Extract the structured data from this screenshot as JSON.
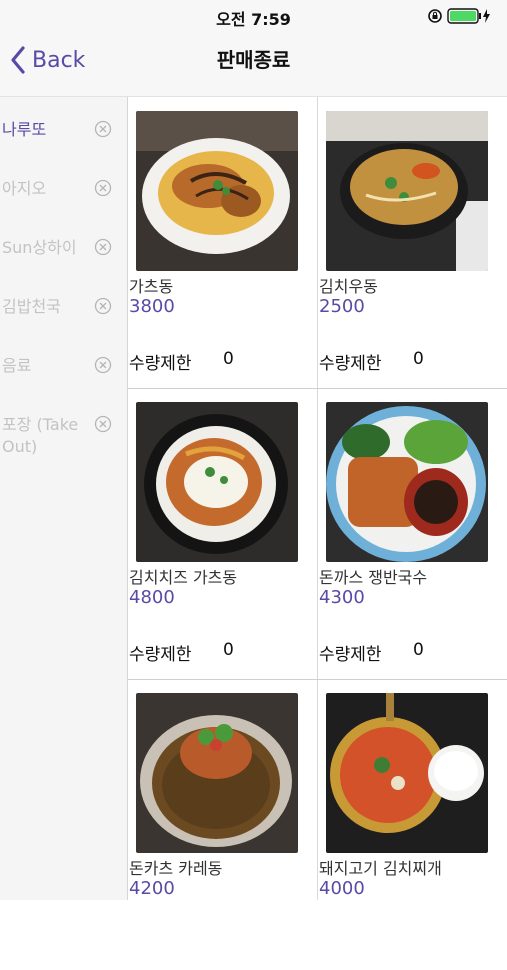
{
  "status_bar": {
    "time": "오전 7:59"
  },
  "nav": {
    "back_label": "Back",
    "title": "판매종료"
  },
  "colors": {
    "accent": "#5b4aa5",
    "inactive": "#c3c3c3"
  },
  "categories": [
    {
      "label": "나루또",
      "active": true
    },
    {
      "label": "아지오",
      "active": false
    },
    {
      "label": "Sun상하이",
      "active": false
    },
    {
      "label": "김밥천국",
      "active": false
    },
    {
      "label": "음료",
      "active": false
    },
    {
      "label": "포장 (Take Out)",
      "active": false
    }
  ],
  "limit_label": "수량제한",
  "items": [
    {
      "name": "가츠동",
      "price": "3800",
      "limit": "0"
    },
    {
      "name": "김치우동",
      "price": "2500",
      "limit": "0"
    },
    {
      "name": "김치치즈 가츠동",
      "price": "4800",
      "limit": "0"
    },
    {
      "name": "돈까스 쟁반국수",
      "price": "4300",
      "limit": "0"
    },
    {
      "name": "돈카츠 카레동",
      "price": "4200",
      "limit": ""
    },
    {
      "name": "돼지고기 김치찌개",
      "price": "4000",
      "limit": ""
    }
  ]
}
